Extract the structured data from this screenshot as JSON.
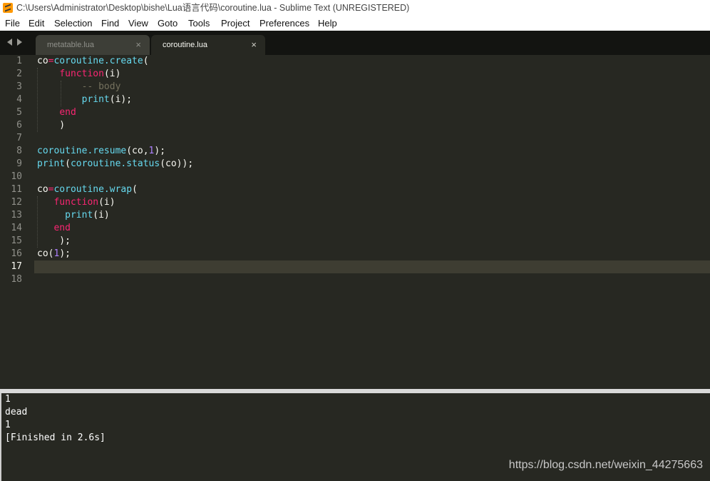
{
  "window": {
    "title": "C:\\Users\\Administrator\\Desktop\\bishe\\Lua语言代码\\coroutine.lua - Sublime Text (UNREGISTERED)"
  },
  "menu": [
    "File",
    "Edit",
    "Selection",
    "Find",
    "View",
    "Goto",
    "Tools",
    "Project",
    "Preferences",
    "Help"
  ],
  "tabs": [
    {
      "label": "metatable.lua",
      "close": "×",
      "active": false
    },
    {
      "label": "coroutine.lua",
      "close": "×",
      "active": true
    }
  ],
  "editor": {
    "current_line": 17,
    "lines": [
      [
        [
          "co",
          "plain"
        ],
        [
          "=",
          "pink"
        ],
        [
          "coroutine.create",
          "blue"
        ],
        [
          "(",
          "plain"
        ]
      ],
      [
        [
          "    ",
          "plain"
        ],
        [
          "function",
          "pink"
        ],
        [
          "(i)",
          "plain"
        ]
      ],
      [
        [
          "        ",
          "plain"
        ],
        [
          "-- body",
          "comment"
        ]
      ],
      [
        [
          "        ",
          "plain"
        ],
        [
          "print",
          "blue"
        ],
        [
          "(i);",
          "plain"
        ]
      ],
      [
        [
          "    ",
          "plain"
        ],
        [
          "end",
          "pink"
        ]
      ],
      [
        [
          "    )",
          "plain"
        ]
      ],
      [],
      [
        [
          "coroutine.resume",
          "blue"
        ],
        [
          "(co,",
          "plain"
        ],
        [
          "1",
          "purple"
        ],
        [
          ");",
          "plain"
        ]
      ],
      [
        [
          "print",
          "blue"
        ],
        [
          "(",
          "plain"
        ],
        [
          "coroutine.status",
          "blue"
        ],
        [
          "(co));",
          "plain"
        ]
      ],
      [],
      [
        [
          "co",
          "plain"
        ],
        [
          "=",
          "pink"
        ],
        [
          "coroutine.wrap",
          "blue"
        ],
        [
          "(",
          "plain"
        ]
      ],
      [
        [
          "   ",
          "plain"
        ],
        [
          "function",
          "pink"
        ],
        [
          "(i)",
          "plain"
        ]
      ],
      [
        [
          "     ",
          "plain"
        ],
        [
          "print",
          "blue"
        ],
        [
          "(i)",
          "plain"
        ]
      ],
      [
        [
          "   ",
          "plain"
        ],
        [
          "end",
          "pink"
        ]
      ],
      [
        [
          "    );",
          "plain"
        ]
      ],
      [
        [
          "co(",
          "plain"
        ],
        [
          "1",
          "purple"
        ],
        [
          ");",
          "plain"
        ]
      ],
      [],
      []
    ]
  },
  "output": {
    "lines": [
      "1",
      "dead",
      "1",
      "[Finished in 2.6s]"
    ]
  },
  "watermark": "https://blog.csdn.net/weixin_44275663",
  "colors": {
    "background": "#272822",
    "keyword": "#f92672",
    "builtin": "#66d9ef",
    "number": "#ae81ff",
    "comment": "#75715e"
  }
}
